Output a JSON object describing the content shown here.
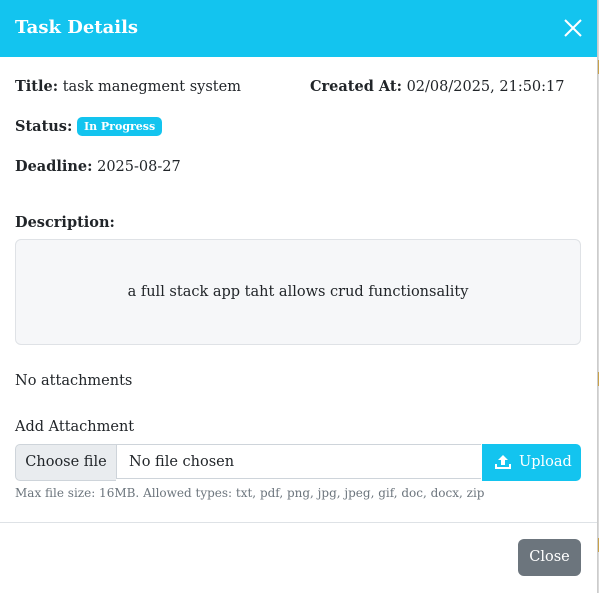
{
  "modal": {
    "title": "Task Details",
    "close_icon": "close-icon"
  },
  "details": {
    "title_label": "Title:",
    "title_value": "task manegment system",
    "created_label": "Created At:",
    "created_value": "02/08/2025, 21:50:17",
    "status_label": "Status:",
    "status_value": "In Progress",
    "deadline_label": "Deadline:",
    "deadline_value": "2025-08-27",
    "description_label": "Description:",
    "description_value": "a full stack app taht allows crud functionsality"
  },
  "attachments": {
    "empty_text": "No attachments",
    "add_label": "Add Attachment",
    "choose_label": "Choose file",
    "file_status": "No file chosen",
    "upload_label": "Upload",
    "upload_icon": "upload-icon",
    "hint": "Max file size: 16MB. Allowed types: txt, pdf, png, jpg, jpeg, gif, doc, docx, zip"
  },
  "footer": {
    "close_label": "Close"
  },
  "colors": {
    "accent": "#13c4ef",
    "secondary": "#6c757d"
  }
}
